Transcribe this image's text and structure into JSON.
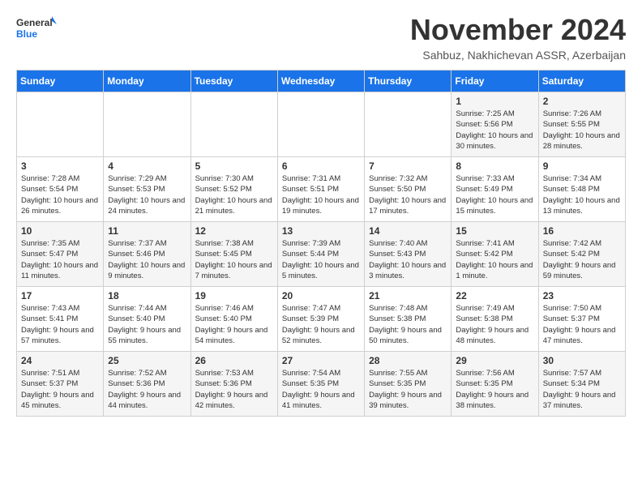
{
  "logo": {
    "line1": "General",
    "line2": "Blue"
  },
  "title": "November 2024",
  "location": "Sahbuz, Nakhichevan ASSR, Azerbaijan",
  "days_of_week": [
    "Sunday",
    "Monday",
    "Tuesday",
    "Wednesday",
    "Thursday",
    "Friday",
    "Saturday"
  ],
  "weeks": [
    [
      {
        "day": "",
        "info": ""
      },
      {
        "day": "",
        "info": ""
      },
      {
        "day": "",
        "info": ""
      },
      {
        "day": "",
        "info": ""
      },
      {
        "day": "",
        "info": ""
      },
      {
        "day": "1",
        "info": "Sunrise: 7:25 AM\nSunset: 5:56 PM\nDaylight: 10 hours and 30 minutes."
      },
      {
        "day": "2",
        "info": "Sunrise: 7:26 AM\nSunset: 5:55 PM\nDaylight: 10 hours and 28 minutes."
      }
    ],
    [
      {
        "day": "3",
        "info": "Sunrise: 7:28 AM\nSunset: 5:54 PM\nDaylight: 10 hours and 26 minutes."
      },
      {
        "day": "4",
        "info": "Sunrise: 7:29 AM\nSunset: 5:53 PM\nDaylight: 10 hours and 24 minutes."
      },
      {
        "day": "5",
        "info": "Sunrise: 7:30 AM\nSunset: 5:52 PM\nDaylight: 10 hours and 21 minutes."
      },
      {
        "day": "6",
        "info": "Sunrise: 7:31 AM\nSunset: 5:51 PM\nDaylight: 10 hours and 19 minutes."
      },
      {
        "day": "7",
        "info": "Sunrise: 7:32 AM\nSunset: 5:50 PM\nDaylight: 10 hours and 17 minutes."
      },
      {
        "day": "8",
        "info": "Sunrise: 7:33 AM\nSunset: 5:49 PM\nDaylight: 10 hours and 15 minutes."
      },
      {
        "day": "9",
        "info": "Sunrise: 7:34 AM\nSunset: 5:48 PM\nDaylight: 10 hours and 13 minutes."
      }
    ],
    [
      {
        "day": "10",
        "info": "Sunrise: 7:35 AM\nSunset: 5:47 PM\nDaylight: 10 hours and 11 minutes."
      },
      {
        "day": "11",
        "info": "Sunrise: 7:37 AM\nSunset: 5:46 PM\nDaylight: 10 hours and 9 minutes."
      },
      {
        "day": "12",
        "info": "Sunrise: 7:38 AM\nSunset: 5:45 PM\nDaylight: 10 hours and 7 minutes."
      },
      {
        "day": "13",
        "info": "Sunrise: 7:39 AM\nSunset: 5:44 PM\nDaylight: 10 hours and 5 minutes."
      },
      {
        "day": "14",
        "info": "Sunrise: 7:40 AM\nSunset: 5:43 PM\nDaylight: 10 hours and 3 minutes."
      },
      {
        "day": "15",
        "info": "Sunrise: 7:41 AM\nSunset: 5:42 PM\nDaylight: 10 hours and 1 minute."
      },
      {
        "day": "16",
        "info": "Sunrise: 7:42 AM\nSunset: 5:42 PM\nDaylight: 9 hours and 59 minutes."
      }
    ],
    [
      {
        "day": "17",
        "info": "Sunrise: 7:43 AM\nSunset: 5:41 PM\nDaylight: 9 hours and 57 minutes."
      },
      {
        "day": "18",
        "info": "Sunrise: 7:44 AM\nSunset: 5:40 PM\nDaylight: 9 hours and 55 minutes."
      },
      {
        "day": "19",
        "info": "Sunrise: 7:46 AM\nSunset: 5:40 PM\nDaylight: 9 hours and 54 minutes."
      },
      {
        "day": "20",
        "info": "Sunrise: 7:47 AM\nSunset: 5:39 PM\nDaylight: 9 hours and 52 minutes."
      },
      {
        "day": "21",
        "info": "Sunrise: 7:48 AM\nSunset: 5:38 PM\nDaylight: 9 hours and 50 minutes."
      },
      {
        "day": "22",
        "info": "Sunrise: 7:49 AM\nSunset: 5:38 PM\nDaylight: 9 hours and 48 minutes."
      },
      {
        "day": "23",
        "info": "Sunrise: 7:50 AM\nSunset: 5:37 PM\nDaylight: 9 hours and 47 minutes."
      }
    ],
    [
      {
        "day": "24",
        "info": "Sunrise: 7:51 AM\nSunset: 5:37 PM\nDaylight: 9 hours and 45 minutes."
      },
      {
        "day": "25",
        "info": "Sunrise: 7:52 AM\nSunset: 5:36 PM\nDaylight: 9 hours and 44 minutes."
      },
      {
        "day": "26",
        "info": "Sunrise: 7:53 AM\nSunset: 5:36 PM\nDaylight: 9 hours and 42 minutes."
      },
      {
        "day": "27",
        "info": "Sunrise: 7:54 AM\nSunset: 5:35 PM\nDaylight: 9 hours and 41 minutes."
      },
      {
        "day": "28",
        "info": "Sunrise: 7:55 AM\nSunset: 5:35 PM\nDaylight: 9 hours and 39 minutes."
      },
      {
        "day": "29",
        "info": "Sunrise: 7:56 AM\nSunset: 5:35 PM\nDaylight: 9 hours and 38 minutes."
      },
      {
        "day": "30",
        "info": "Sunrise: 7:57 AM\nSunset: 5:34 PM\nDaylight: 9 hours and 37 minutes."
      }
    ]
  ]
}
